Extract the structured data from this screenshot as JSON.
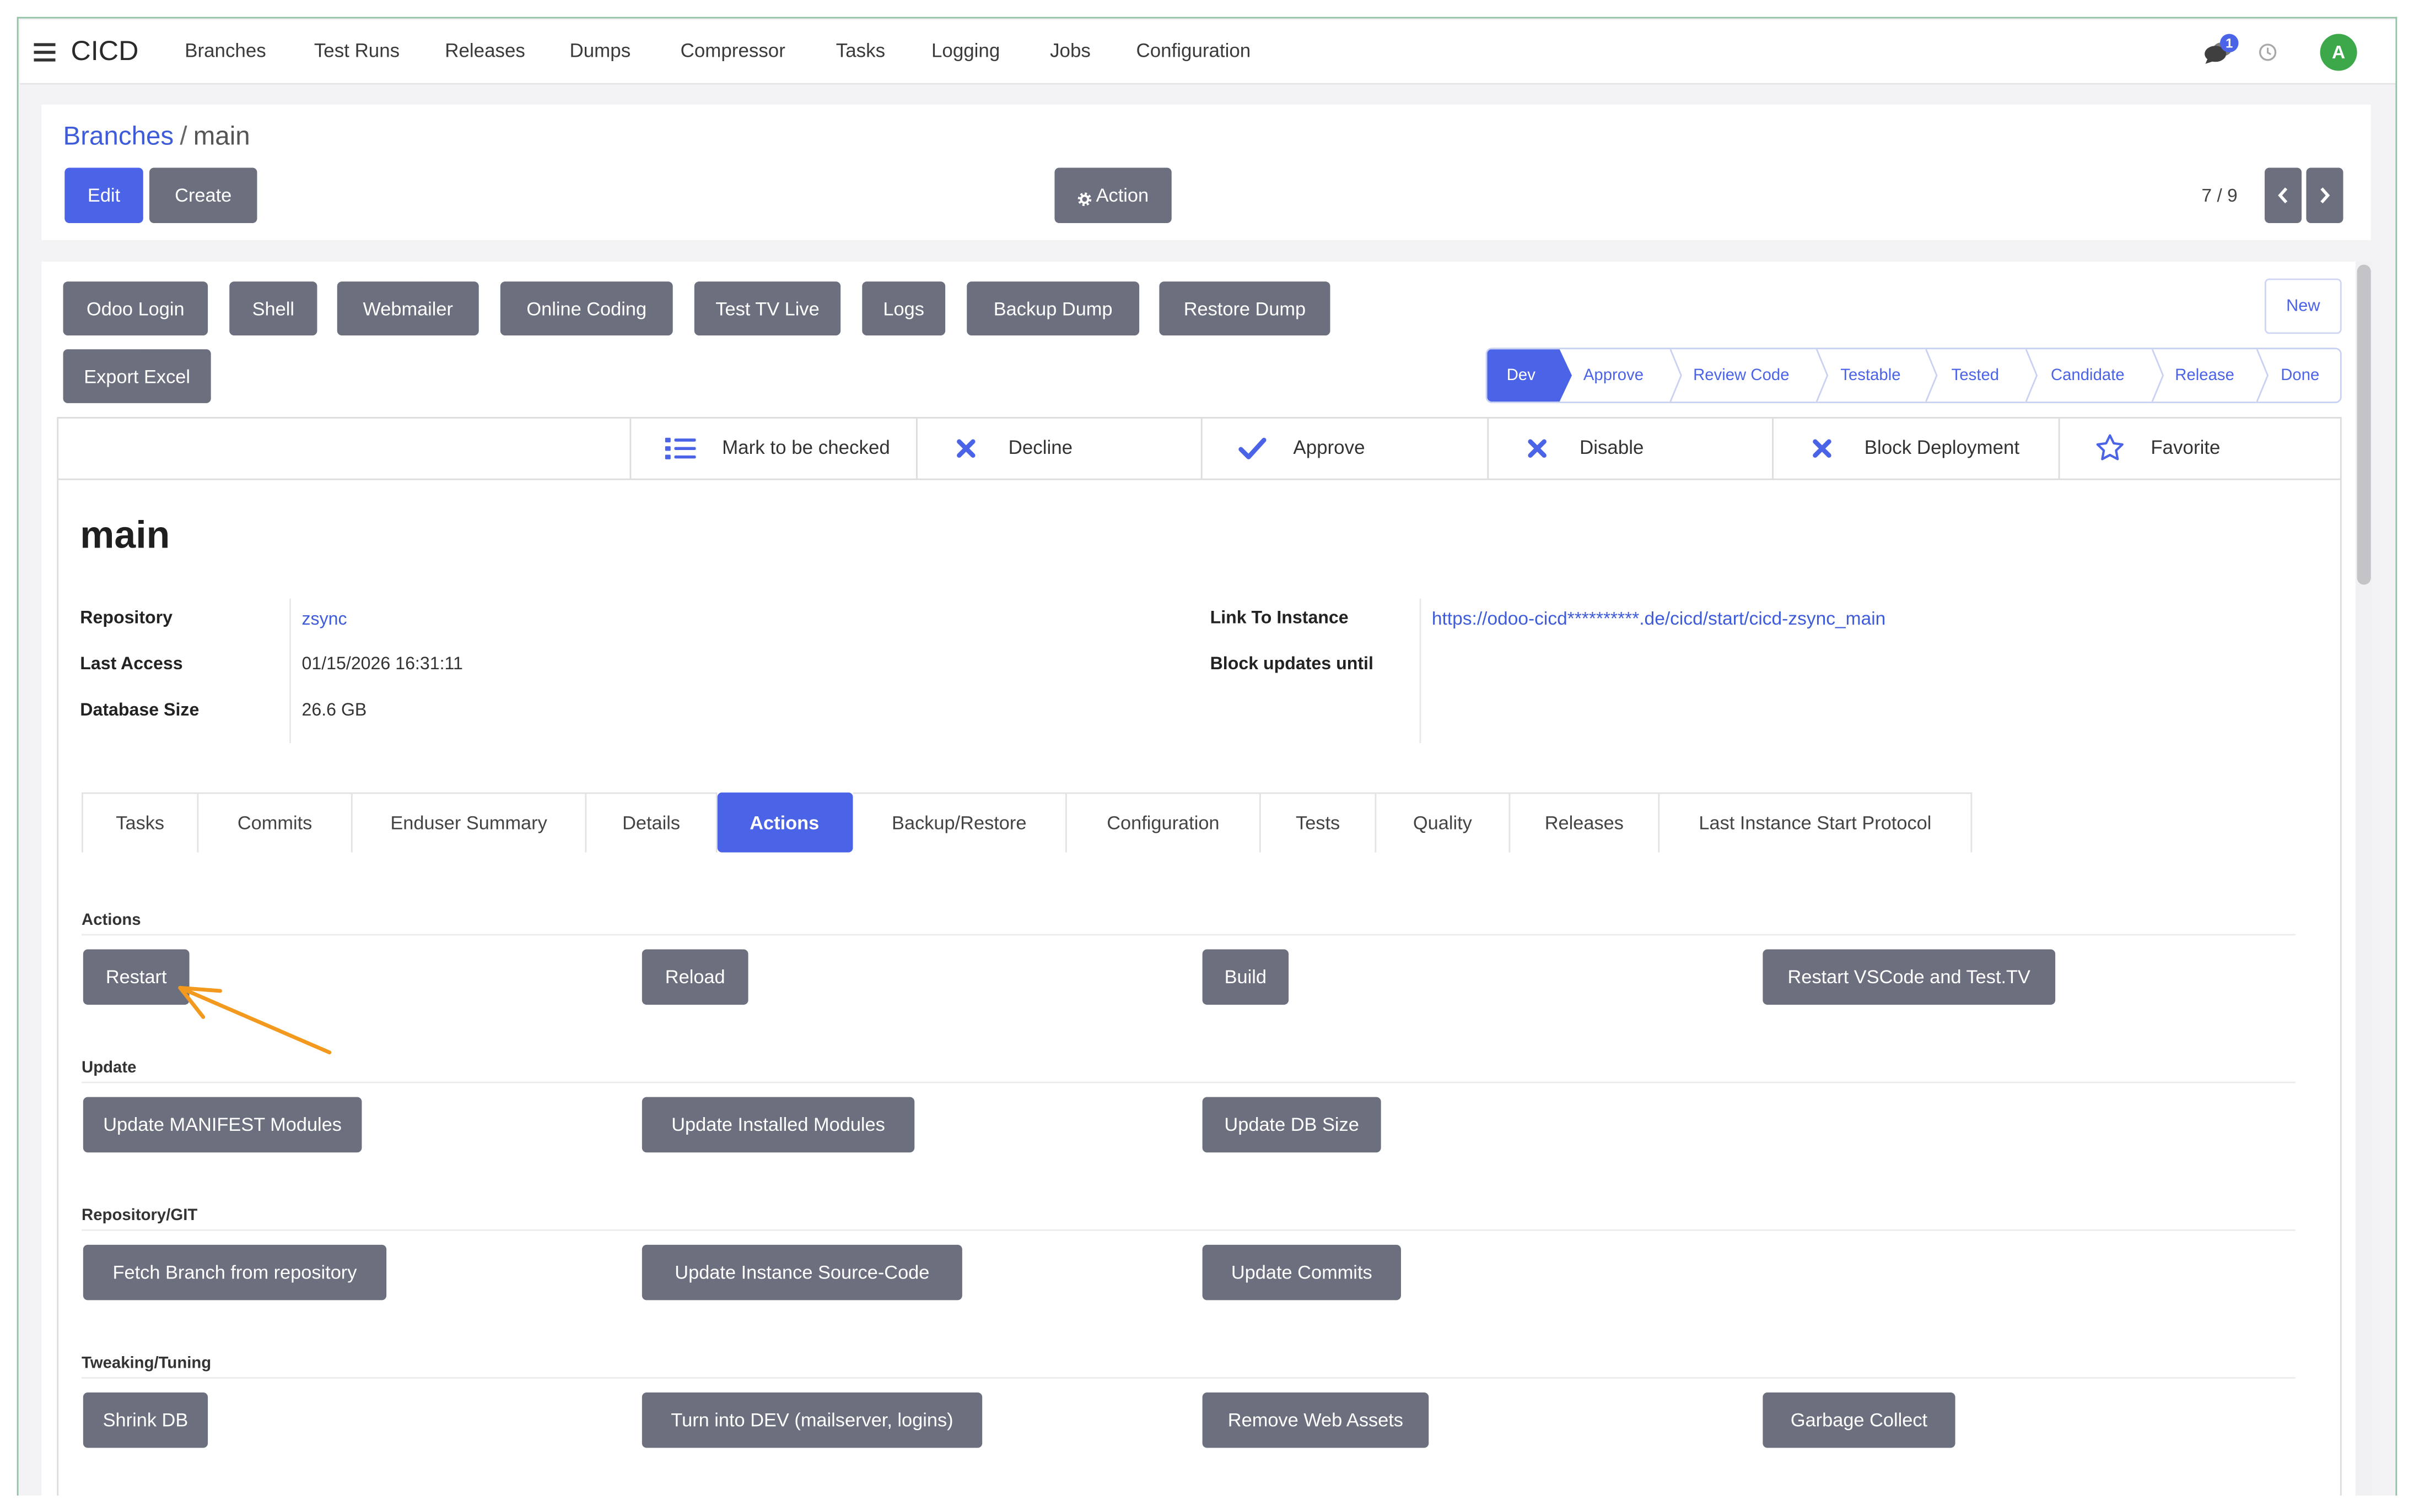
{
  "app": {
    "name": "CICD"
  },
  "navbar": {
    "menu_icon": "hamburger-icon",
    "items": [
      "Branches",
      "Test Runs",
      "Releases",
      "Dumps",
      "Compressor",
      "Tasks",
      "Logging",
      "Jobs",
      "Configuration"
    ],
    "systray": {
      "messages_icon": "chat-bubbles-icon",
      "messages_badge": "1",
      "activity_icon": "clock-icon",
      "avatar_initial": "A"
    }
  },
  "breadcrumb": {
    "parent": "Branches",
    "separator": "/",
    "current": "main"
  },
  "control_panel": {
    "edit_label": "Edit",
    "create_label": "Create",
    "action_icon": "gear-icon",
    "action_label": "Action",
    "pager": "7 / 9",
    "prev_icon": "chevron-left-icon",
    "next_icon": "chevron-right-icon"
  },
  "header_buttons": [
    "Odoo Login",
    "Shell",
    "Webmailer",
    "Online Coding",
    "Test TV Live",
    "Logs",
    "Backup Dump",
    "Restore Dump",
    "Export Excel"
  ],
  "new_button_label": "New",
  "statusbar": {
    "stages": [
      "Dev",
      "Approve",
      "Review Code",
      "Testable",
      "Tested",
      "Candidate",
      "Release",
      "Done"
    ],
    "active_index": 0
  },
  "button_box": [
    {
      "label": "Mark to be checked",
      "icon": "list-icon"
    },
    {
      "label": "Decline",
      "icon": "x-icon"
    },
    {
      "label": "Approve",
      "icon": "check-icon"
    },
    {
      "label": "Disable",
      "icon": "x-icon"
    },
    {
      "label": "Block Deployment",
      "icon": "x-icon"
    },
    {
      "label": "Favorite",
      "icon": "star-outline-icon"
    }
  ],
  "record": {
    "title": "main",
    "left_fields": [
      {
        "label": "Repository",
        "value": "zsync"
      },
      {
        "label": "Last Access",
        "value": "01/15/2026 16:31:11"
      },
      {
        "label": "Database Size",
        "value": "26.6 GB"
      }
    ],
    "right_fields": [
      {
        "label": "Link To Instance",
        "value": "https://odoo-cicd**********.de/cicd/start/cicd-zsync_main"
      },
      {
        "label": "Block updates until"
      }
    ]
  },
  "tabs": {
    "items": [
      "Tasks",
      "Commits",
      "Enduser Summary",
      "Details",
      "Actions",
      "Backup/Restore",
      "Configuration",
      "Tests",
      "Quality",
      "Releases",
      "Last Instance Start Protocol"
    ],
    "active_index": 4
  },
  "action_groups": [
    {
      "title": "Actions",
      "buttons": [
        "Restart",
        "Reload",
        "Build",
        "Restart VSCode and Test.TV"
      ]
    },
    {
      "title": "Update",
      "buttons": [
        "Update MANIFEST Modules",
        "Update Installed Modules",
        "Update DB Size"
      ]
    },
    {
      "title": "Repository/GIT",
      "buttons": [
        "Fetch Branch from repository",
        "Update Instance Source-Code",
        "Update Commits"
      ]
    },
    {
      "title": "Tweaking/Tuning",
      "buttons": [
        "Shrink DB",
        "Turn into DEV (mailserver, logins)",
        "Remove Web Assets",
        "Garbage Collect"
      ]
    }
  ],
  "colors": {
    "primary": "#4b63e6",
    "secondary_button": "#6c6f7e",
    "link": "#3e5bd9",
    "avatar": "#3da84a",
    "frame": "#93c2a7",
    "background": "#f3f3f5",
    "annotation_arrow": "#f39a1e"
  }
}
